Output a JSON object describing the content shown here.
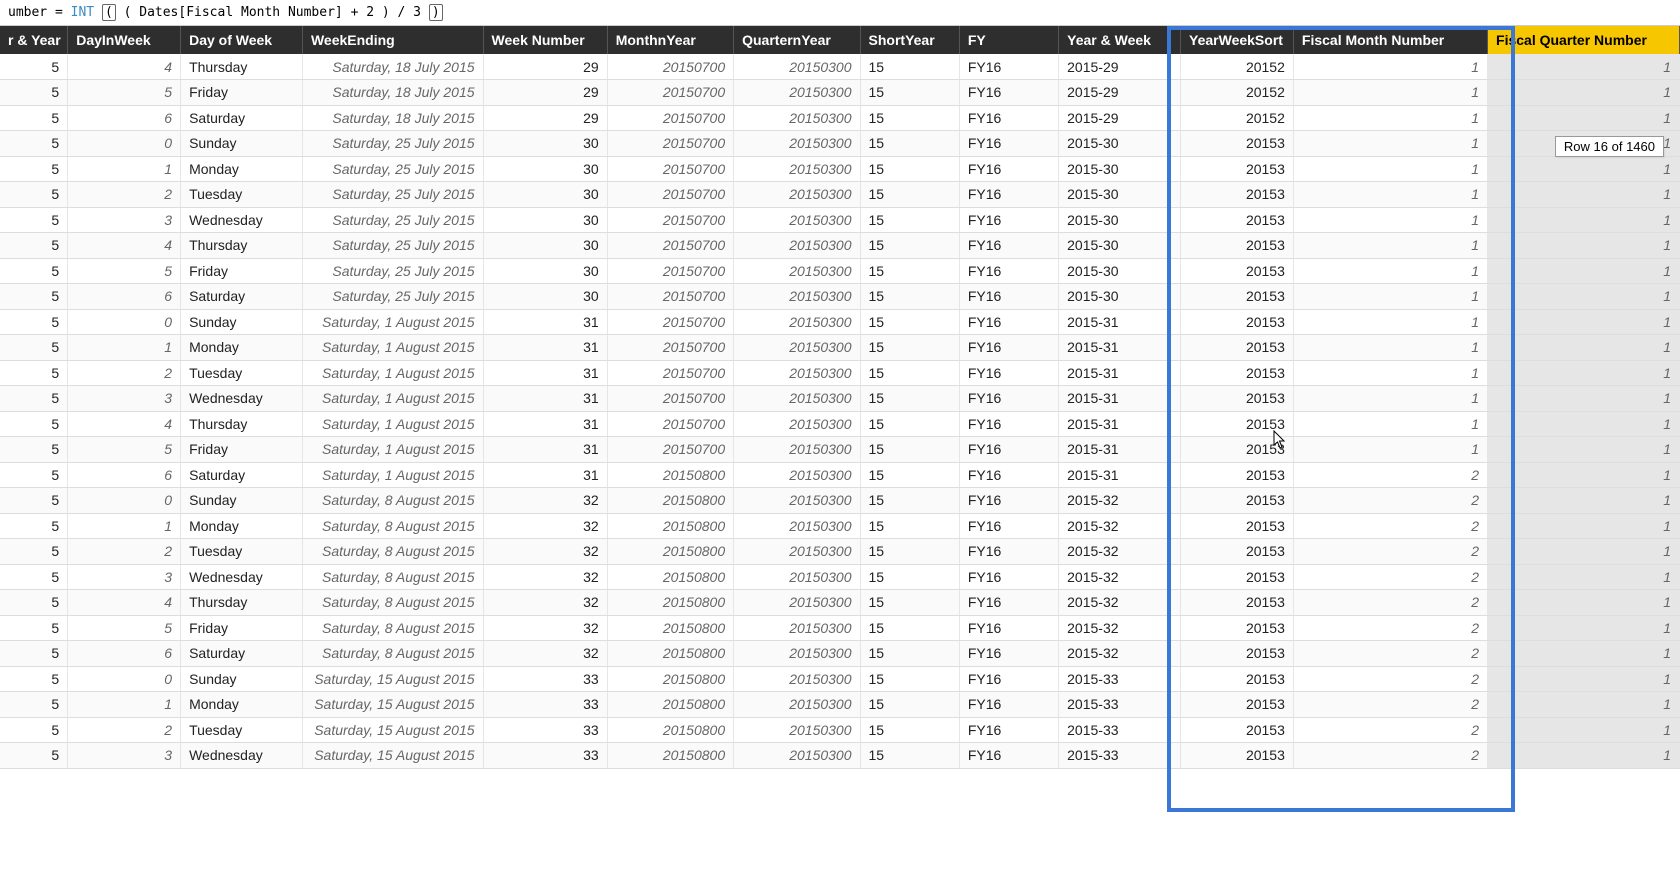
{
  "formula": {
    "prefix_text": "umber = ",
    "fn": "INT",
    "open_box": "(",
    "body": " ( Dates[Fiscal Month Number] + 2 ) / 3 ",
    "close_box": ")"
  },
  "tooltip": "Row 16 of 1460",
  "columns": [
    {
      "key": "qy",
      "label": "r & Year",
      "cls": "col-qy",
      "align": "num"
    },
    {
      "key": "diw",
      "label": "DayInWeek",
      "cls": "col-diw",
      "align": "num italic"
    },
    {
      "key": "dow",
      "label": "Day of Week",
      "cls": "col-dow",
      "align": "left"
    },
    {
      "key": "we",
      "label": "WeekEnding",
      "cls": "col-we",
      "align": "num italic"
    },
    {
      "key": "wn",
      "label": "Week Number",
      "cls": "col-wn",
      "align": "num"
    },
    {
      "key": "mny",
      "label": "MonthnYear",
      "cls": "col-mny",
      "align": "num italic"
    },
    {
      "key": "qny",
      "label": "QuarternYear",
      "cls": "col-qny",
      "align": "num italic"
    },
    {
      "key": "sy",
      "label": "ShortYear",
      "cls": "col-sy",
      "align": "left"
    },
    {
      "key": "fy",
      "label": "FY",
      "cls": "col-fy",
      "align": "left"
    },
    {
      "key": "yw",
      "label": "Year & Week",
      "cls": "col-yw",
      "align": "left"
    },
    {
      "key": "yws",
      "label": "YearWeekSort",
      "cls": "col-yws",
      "align": "num"
    },
    {
      "key": "fmn",
      "label": "Fiscal Month Number",
      "cls": "col-fmn",
      "align": "num italic",
      "highlighted": true
    },
    {
      "key": "fqn",
      "label": "Fiscal Quarter Number",
      "cls": "col-fqn",
      "align": "active-col",
      "active": true
    }
  ],
  "rows": [
    {
      "qy": "5",
      "diw": "4",
      "dow": "Thursday",
      "we": "Saturday, 18 July 2015",
      "wn": "29",
      "mny": "20150700",
      "qny": "20150300",
      "sy": "15",
      "fy": "FY16",
      "yw": "2015-29",
      "yws": "20152",
      "fmn": "1",
      "fqn": "1"
    },
    {
      "qy": "5",
      "diw": "5",
      "dow": "Friday",
      "we": "Saturday, 18 July 2015",
      "wn": "29",
      "mny": "20150700",
      "qny": "20150300",
      "sy": "15",
      "fy": "FY16",
      "yw": "2015-29",
      "yws": "20152",
      "fmn": "1",
      "fqn": "1"
    },
    {
      "qy": "5",
      "diw": "6",
      "dow": "Saturday",
      "we": "Saturday, 18 July 2015",
      "wn": "29",
      "mny": "20150700",
      "qny": "20150300",
      "sy": "15",
      "fy": "FY16",
      "yw": "2015-29",
      "yws": "20152",
      "fmn": "1",
      "fqn": "1"
    },
    {
      "qy": "5",
      "diw": "0",
      "dow": "Sunday",
      "we": "Saturday, 25 July 2015",
      "wn": "30",
      "mny": "20150700",
      "qny": "20150300",
      "sy": "15",
      "fy": "FY16",
      "yw": "2015-30",
      "yws": "20153",
      "fmn": "1",
      "fqn": "1"
    },
    {
      "qy": "5",
      "diw": "1",
      "dow": "Monday",
      "we": "Saturday, 25 July 2015",
      "wn": "30",
      "mny": "20150700",
      "qny": "20150300",
      "sy": "15",
      "fy": "FY16",
      "yw": "2015-30",
      "yws": "20153",
      "fmn": "1",
      "fqn": "1"
    },
    {
      "qy": "5",
      "diw": "2",
      "dow": "Tuesday",
      "we": "Saturday, 25 July 2015",
      "wn": "30",
      "mny": "20150700",
      "qny": "20150300",
      "sy": "15",
      "fy": "FY16",
      "yw": "2015-30",
      "yws": "20153",
      "fmn": "1",
      "fqn": "1"
    },
    {
      "qy": "5",
      "diw": "3",
      "dow": "Wednesday",
      "we": "Saturday, 25 July 2015",
      "wn": "30",
      "mny": "20150700",
      "qny": "20150300",
      "sy": "15",
      "fy": "FY16",
      "yw": "2015-30",
      "yws": "20153",
      "fmn": "1",
      "fqn": "1"
    },
    {
      "qy": "5",
      "diw": "4",
      "dow": "Thursday",
      "we": "Saturday, 25 July 2015",
      "wn": "30",
      "mny": "20150700",
      "qny": "20150300",
      "sy": "15",
      "fy": "FY16",
      "yw": "2015-30",
      "yws": "20153",
      "fmn": "1",
      "fqn": "1"
    },
    {
      "qy": "5",
      "diw": "5",
      "dow": "Friday",
      "we": "Saturday, 25 July 2015",
      "wn": "30",
      "mny": "20150700",
      "qny": "20150300",
      "sy": "15",
      "fy": "FY16",
      "yw": "2015-30",
      "yws": "20153",
      "fmn": "1",
      "fqn": "1"
    },
    {
      "qy": "5",
      "diw": "6",
      "dow": "Saturday",
      "we": "Saturday, 25 July 2015",
      "wn": "30",
      "mny": "20150700",
      "qny": "20150300",
      "sy": "15",
      "fy": "FY16",
      "yw": "2015-30",
      "yws": "20153",
      "fmn": "1",
      "fqn": "1"
    },
    {
      "qy": "5",
      "diw": "0",
      "dow": "Sunday",
      "we": "Saturday, 1 August 2015",
      "wn": "31",
      "mny": "20150700",
      "qny": "20150300",
      "sy": "15",
      "fy": "FY16",
      "yw": "2015-31",
      "yws": "20153",
      "fmn": "1",
      "fqn": "1"
    },
    {
      "qy": "5",
      "diw": "1",
      "dow": "Monday",
      "we": "Saturday, 1 August 2015",
      "wn": "31",
      "mny": "20150700",
      "qny": "20150300",
      "sy": "15",
      "fy": "FY16",
      "yw": "2015-31",
      "yws": "20153",
      "fmn": "1",
      "fqn": "1"
    },
    {
      "qy": "5",
      "diw": "2",
      "dow": "Tuesday",
      "we": "Saturday, 1 August 2015",
      "wn": "31",
      "mny": "20150700",
      "qny": "20150300",
      "sy": "15",
      "fy": "FY16",
      "yw": "2015-31",
      "yws": "20153",
      "fmn": "1",
      "fqn": "1"
    },
    {
      "qy": "5",
      "diw": "3",
      "dow": "Wednesday",
      "we": "Saturday, 1 August 2015",
      "wn": "31",
      "mny": "20150700",
      "qny": "20150300",
      "sy": "15",
      "fy": "FY16",
      "yw": "2015-31",
      "yws": "20153",
      "fmn": "1",
      "fqn": "1"
    },
    {
      "qy": "5",
      "diw": "4",
      "dow": "Thursday",
      "we": "Saturday, 1 August 2015",
      "wn": "31",
      "mny": "20150700",
      "qny": "20150300",
      "sy": "15",
      "fy": "FY16",
      "yw": "2015-31",
      "yws": "20153",
      "fmn": "1",
      "fqn": "1"
    },
    {
      "qy": "5",
      "diw": "5",
      "dow": "Friday",
      "we": "Saturday, 1 August 2015",
      "wn": "31",
      "mny": "20150700",
      "qny": "20150300",
      "sy": "15",
      "fy": "FY16",
      "yw": "2015-31",
      "yws": "20153",
      "fmn": "1",
      "fqn": "1"
    },
    {
      "qy": "5",
      "diw": "6",
      "dow": "Saturday",
      "we": "Saturday, 1 August 2015",
      "wn": "31",
      "mny": "20150800",
      "qny": "20150300",
      "sy": "15",
      "fy": "FY16",
      "yw": "2015-31",
      "yws": "20153",
      "fmn": "2",
      "fqn": "1"
    },
    {
      "qy": "5",
      "diw": "0",
      "dow": "Sunday",
      "we": "Saturday, 8 August 2015",
      "wn": "32",
      "mny": "20150800",
      "qny": "20150300",
      "sy": "15",
      "fy": "FY16",
      "yw": "2015-32",
      "yws": "20153",
      "fmn": "2",
      "fqn": "1"
    },
    {
      "qy": "5",
      "diw": "1",
      "dow": "Monday",
      "we": "Saturday, 8 August 2015",
      "wn": "32",
      "mny": "20150800",
      "qny": "20150300",
      "sy": "15",
      "fy": "FY16",
      "yw": "2015-32",
      "yws": "20153",
      "fmn": "2",
      "fqn": "1"
    },
    {
      "qy": "5",
      "diw": "2",
      "dow": "Tuesday",
      "we": "Saturday, 8 August 2015",
      "wn": "32",
      "mny": "20150800",
      "qny": "20150300",
      "sy": "15",
      "fy": "FY16",
      "yw": "2015-32",
      "yws": "20153",
      "fmn": "2",
      "fqn": "1"
    },
    {
      "qy": "5",
      "diw": "3",
      "dow": "Wednesday",
      "we": "Saturday, 8 August 2015",
      "wn": "32",
      "mny": "20150800",
      "qny": "20150300",
      "sy": "15",
      "fy": "FY16",
      "yw": "2015-32",
      "yws": "20153",
      "fmn": "2",
      "fqn": "1"
    },
    {
      "qy": "5",
      "diw": "4",
      "dow": "Thursday",
      "we": "Saturday, 8 August 2015",
      "wn": "32",
      "mny": "20150800",
      "qny": "20150300",
      "sy": "15",
      "fy": "FY16",
      "yw": "2015-32",
      "yws": "20153",
      "fmn": "2",
      "fqn": "1"
    },
    {
      "qy": "5",
      "diw": "5",
      "dow": "Friday",
      "we": "Saturday, 8 August 2015",
      "wn": "32",
      "mny": "20150800",
      "qny": "20150300",
      "sy": "15",
      "fy": "FY16",
      "yw": "2015-32",
      "yws": "20153",
      "fmn": "2",
      "fqn": "1"
    },
    {
      "qy": "5",
      "diw": "6",
      "dow": "Saturday",
      "we": "Saturday, 8 August 2015",
      "wn": "32",
      "mny": "20150800",
      "qny": "20150300",
      "sy": "15",
      "fy": "FY16",
      "yw": "2015-32",
      "yws": "20153",
      "fmn": "2",
      "fqn": "1"
    },
    {
      "qy": "5",
      "diw": "0",
      "dow": "Sunday",
      "we": "Saturday, 15 August 2015",
      "wn": "33",
      "mny": "20150800",
      "qny": "20150300",
      "sy": "15",
      "fy": "FY16",
      "yw": "2015-33",
      "yws": "20153",
      "fmn": "2",
      "fqn": "1"
    },
    {
      "qy": "5",
      "diw": "1",
      "dow": "Monday",
      "we": "Saturday, 15 August 2015",
      "wn": "33",
      "mny": "20150800",
      "qny": "20150300",
      "sy": "15",
      "fy": "FY16",
      "yw": "2015-33",
      "yws": "20153",
      "fmn": "2",
      "fqn": "1"
    },
    {
      "qy": "5",
      "diw": "2",
      "dow": "Tuesday",
      "we": "Saturday, 15 August 2015",
      "wn": "33",
      "mny": "20150800",
      "qny": "20150300",
      "sy": "15",
      "fy": "FY16",
      "yw": "2015-33",
      "yws": "20153",
      "fmn": "2",
      "fqn": "1"
    },
    {
      "qy": "5",
      "diw": "3",
      "dow": "Wednesday",
      "we": "Saturday, 15 August 2015",
      "wn": "33",
      "mny": "20150800",
      "qny": "20150300",
      "sy": "15",
      "fy": "FY16",
      "yw": "2015-33",
      "yws": "20153",
      "fmn": "2",
      "fqn": "1"
    }
  ]
}
